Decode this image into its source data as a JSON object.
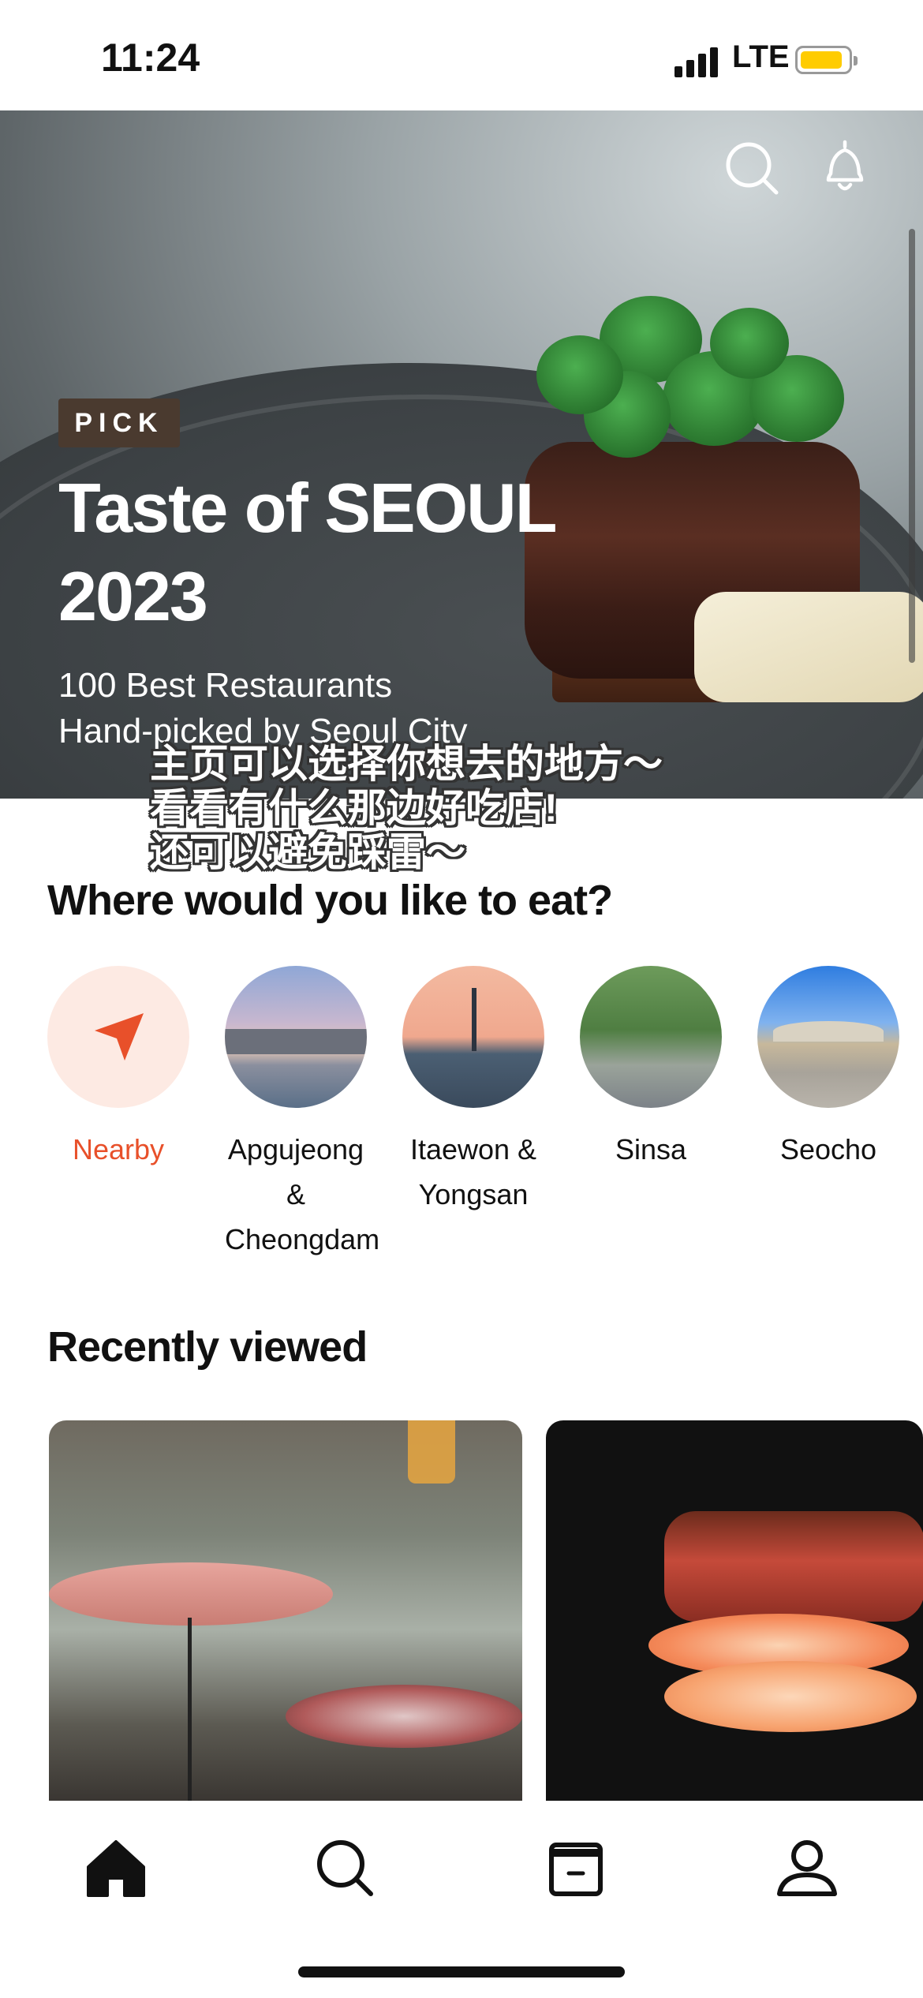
{
  "status_bar": {
    "time": "11:24",
    "network": "LTE"
  },
  "hero": {
    "badge": "PICK",
    "title": "Taste of SEOUL 2023",
    "subtitle_line1": "100 Best Restaurants",
    "subtitle_line2": "Hand-picked by Seoul City"
  },
  "overlay_caption": {
    "line1": "主页可以选择你想去的地方～",
    "line2": "看看有什么那边好吃店!",
    "line3": "还可以避免踩雷～"
  },
  "locations": {
    "title": "Where would you like to eat?",
    "items": [
      {
        "label": "Nearby",
        "active": true
      },
      {
        "label": "Apgujeong & Cheongdam"
      },
      {
        "label": "Itaewon & Yongsan"
      },
      {
        "label": "Sinsa"
      },
      {
        "label": "Seocho"
      }
    ]
  },
  "recently_viewed": {
    "title": "Recently viewed"
  },
  "bottom_nav": [
    "home-icon",
    "search-icon",
    "calendar-icon",
    "profile-icon"
  ],
  "colors": {
    "accent": "#e8502a",
    "badge_bg": "#4a3a2f"
  }
}
